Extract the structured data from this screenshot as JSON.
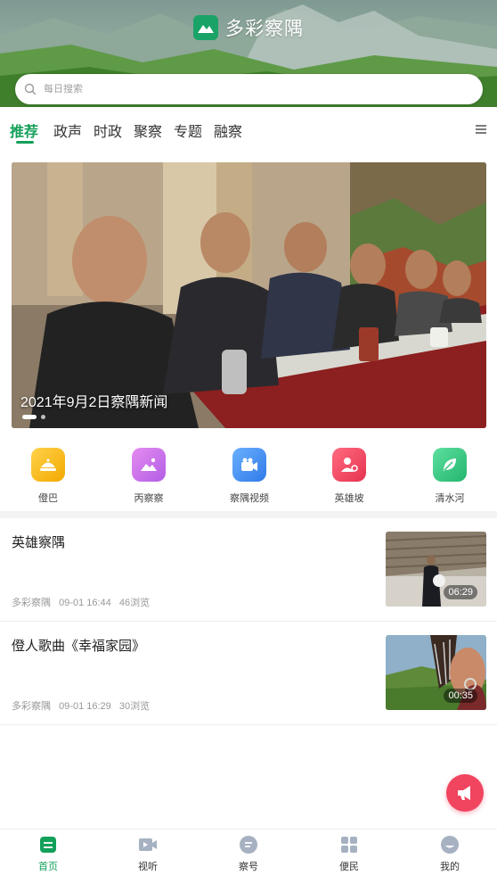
{
  "header": {
    "title": "多彩察隅",
    "logo_icon": "mountain-logo-icon"
  },
  "search": {
    "placeholder": "每日搜索"
  },
  "tabs": [
    {
      "label": "推荐",
      "active": true
    },
    {
      "label": "政声"
    },
    {
      "label": "时政"
    },
    {
      "label": "聚察"
    },
    {
      "label": "专题"
    },
    {
      "label": "融察"
    }
  ],
  "banner": {
    "caption": "2021年9月2日察隅新闻",
    "slide_count": 2,
    "active_slide": 1
  },
  "quick_entries": [
    {
      "label": "僜巴",
      "icon": "dish-icon",
      "color": "#f7b500"
    },
    {
      "label": "丙察察",
      "icon": "picture-icon",
      "color": "#c56be8"
    },
    {
      "label": "察隅视频",
      "icon": "video-camera-icon",
      "color": "#3d8bf2"
    },
    {
      "label": "英雄坡",
      "icon": "person-icon",
      "color": "#f0445f"
    },
    {
      "label": "清水河",
      "icon": "leaf-icon",
      "color": "#2fbf7a"
    }
  ],
  "news": [
    {
      "title": "英雄察隅",
      "source": "多彩察隅",
      "time": "09-01 16:44",
      "views": "46浏览",
      "duration": "06:29"
    },
    {
      "title": "僜人歌曲《幸福家园》",
      "source": "多彩察隅",
      "time": "09-01 16:29",
      "views": "30浏览",
      "duration": "00:35"
    }
  ],
  "bottom_nav": [
    {
      "label": "首页",
      "icon": "home-icon",
      "active": true
    },
    {
      "label": "视听",
      "icon": "video-icon"
    },
    {
      "label": "察号",
      "icon": "chat-icon"
    },
    {
      "label": "便民",
      "icon": "grid-icon"
    },
    {
      "label": "我的",
      "icon": "profile-icon"
    }
  ],
  "colors": {
    "accent": "#13a05a",
    "fab": "#f0445f"
  }
}
